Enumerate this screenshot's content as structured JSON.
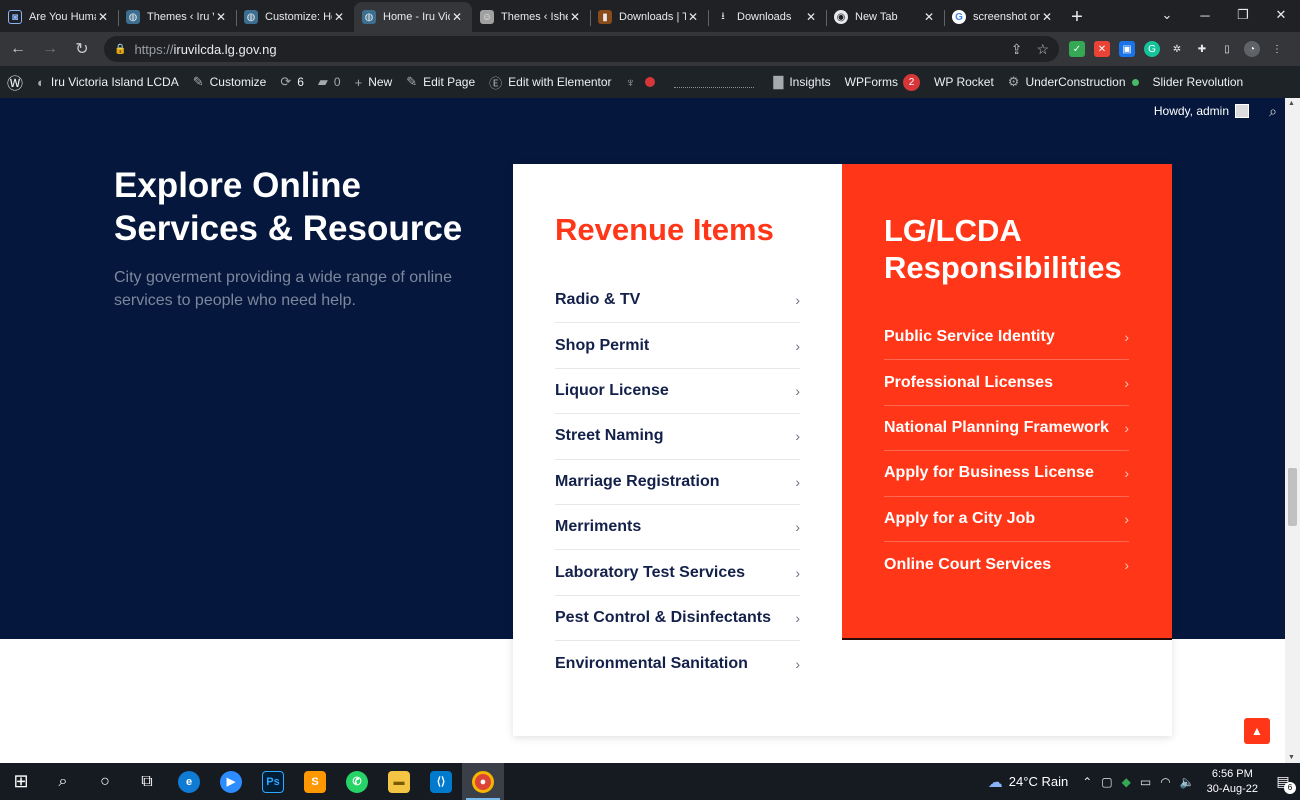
{
  "browser": {
    "tabs": [
      {
        "title": "Are You Huma",
        "favicon_color": "#5f6368",
        "active": false
      },
      {
        "title": "Themes ‹ Iru V",
        "favicon_color": "#3c6e8f",
        "active": false
      },
      {
        "title": "Customize: Ho",
        "favicon_color": "#3c6e8f",
        "active": false
      },
      {
        "title": "Home - Iru Vic",
        "favicon_color": "#3c6e8f",
        "active": true
      },
      {
        "title": "Themes ‹ Ishe",
        "favicon_color": "#a0a0a0",
        "active": false
      },
      {
        "title": "Downloads | T",
        "favicon_color": "#e8741f",
        "active": false
      },
      {
        "title": "Downloads",
        "favicon_color": "#e8eaed",
        "active": false
      },
      {
        "title": "New Tab",
        "favicon_color": "#e8eaed",
        "active": false
      },
      {
        "title": "screenshot on",
        "favicon_color": "#4285f4",
        "active": false
      }
    ],
    "url_scheme": "https://",
    "url_host": "iruvilcda.lg.gov.ng"
  },
  "adminbar": {
    "site_name": "Iru Victoria Island LCDA",
    "customize": "Customize",
    "updates_count": "6",
    "comments_count": "0",
    "new": "New",
    "edit_page": "Edit Page",
    "edit_elementor": "Edit with Elementor",
    "insights": "Insights",
    "wpforms": "WPForms",
    "wpforms_count": "2",
    "wp_rocket": "WP Rocket",
    "under_construction": "UnderConstruction",
    "slider_revolution": "Slider Revolution",
    "howdy": "Howdy, admin"
  },
  "hero": {
    "title": "Explore Online Services & Resource",
    "subtitle": "City goverment providing a wide range of online services to people who need help."
  },
  "revenue": {
    "title": "Revenue Items",
    "items": [
      "Radio & TV",
      "Shop Permit",
      "Liquor License",
      "Street Naming",
      "Marriage Registration",
      "Merriments",
      "Laboratory Test Services",
      "Pest Control & Disinfectants",
      "Environmental Sanitation"
    ]
  },
  "responsibilities": {
    "title": "LG/LCDA Responsibilities",
    "items": [
      "Public Service Identity",
      "Professional Licenses",
      "National Planning Framework",
      "Apply for Business License",
      "Apply for a City Job",
      "Online Court Services"
    ]
  },
  "taskbar": {
    "weather": "24°C  Rain",
    "time": "6:56 PM",
    "date": "30-Aug-22",
    "notification_count": "6"
  },
  "colors": {
    "hero_bg": "#05173c",
    "accent_red": "#ff3617",
    "link_navy": "#13204a"
  }
}
